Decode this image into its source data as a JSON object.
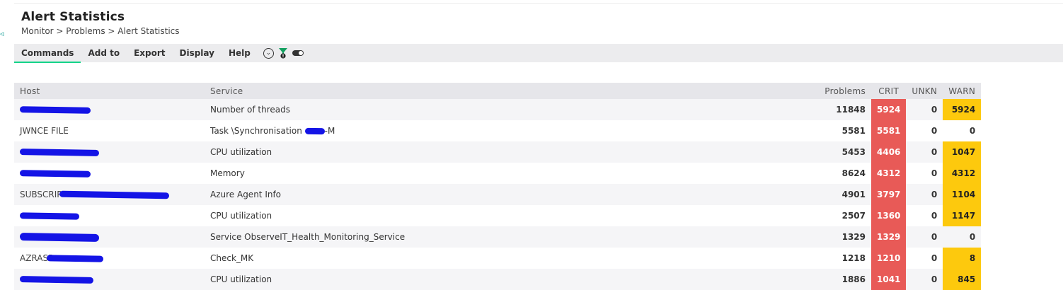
{
  "page": {
    "title": "Alert Statistics",
    "breadcrumb": "Monitor > Problems > Alert Statistics"
  },
  "menu": {
    "items": [
      {
        "label": "Commands",
        "active": true
      },
      {
        "label": "Add to",
        "active": false
      },
      {
        "label": "Export",
        "active": false
      },
      {
        "label": "Display",
        "active": false
      },
      {
        "label": "Help",
        "active": false
      }
    ],
    "tools": [
      "circle-chevron-down-icon",
      "filter-icon",
      "toggle-switch-icon"
    ]
  },
  "table": {
    "headers": {
      "host": "Host",
      "service": "Service",
      "problems": "Problems",
      "crit": "CRIT",
      "unkn": "UNKN",
      "warn": "WARN"
    },
    "rows": [
      {
        "host": "",
        "service": "Number of threads",
        "problems": "11848",
        "crit": "5924",
        "unkn": "0",
        "warn": "5924"
      },
      {
        "host": "JWNCE FILE",
        "service": "Task \\Synchronisation",
        "service_suffix": "-M",
        "problems": "5581",
        "crit": "5581",
        "unkn": "0",
        "warn": "0"
      },
      {
        "host": "",
        "service": "CPU utilization",
        "problems": "5453",
        "crit": "4406",
        "unkn": "0",
        "warn": "1047"
      },
      {
        "host": "",
        "service": "Memory",
        "problems": "8624",
        "crit": "4312",
        "unkn": "0",
        "warn": "4312"
      },
      {
        "host": "SUBSCRIP",
        "service": "Azure Agent Info",
        "problems": "4901",
        "crit": "3797",
        "unkn": "0",
        "warn": "1104"
      },
      {
        "host": "",
        "service": "CPU utilization",
        "problems": "2507",
        "crit": "1360",
        "unkn": "0",
        "warn": "1147"
      },
      {
        "host": "",
        "service": "Service ObserveIT_Health_Monitoring_Service",
        "problems": "1329",
        "crit": "1329",
        "unkn": "0",
        "warn": "0"
      },
      {
        "host": "AZRASR",
        "service": "Check_MK",
        "problems": "1218",
        "crit": "1210",
        "unkn": "0",
        "warn": "8"
      },
      {
        "host": "",
        "service": "CPU utilization",
        "problems": "1886",
        "crit": "1041",
        "unkn": "0",
        "warn": "845"
      }
    ]
  },
  "colors": {
    "crit": "#e85a57",
    "warn": "#fdc90d",
    "active_tab_underline": "#13d389",
    "redaction": "#1414e6"
  }
}
